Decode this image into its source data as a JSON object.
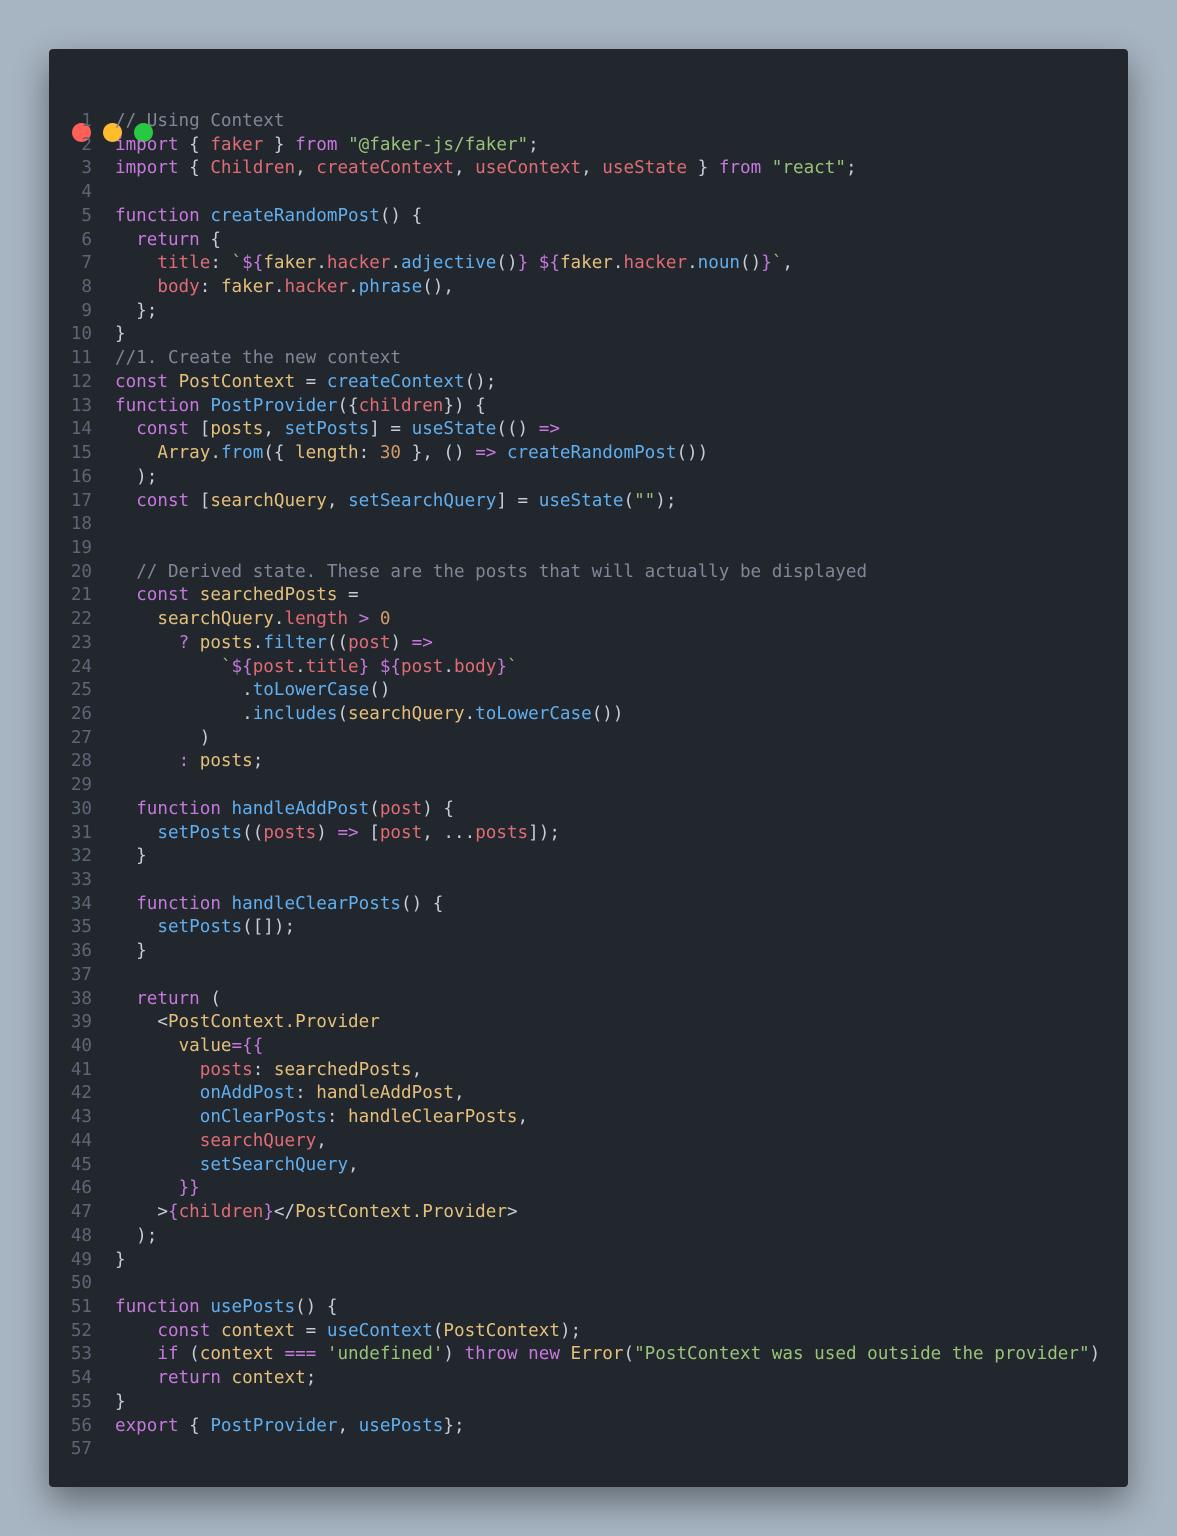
{
  "window": {
    "controls": [
      {
        "name": "close",
        "color": "#fe5f57"
      },
      {
        "name": "minimize",
        "color": "#febc2e"
      },
      {
        "name": "zoom",
        "color": "#28c840"
      }
    ]
  },
  "colors": {
    "background": "#a7b4c1",
    "editor": "#22272e",
    "keyword": "#c678dd",
    "function": "#61afef",
    "string": "#98c379",
    "variable": "#e06c75",
    "class": "#e5c07b",
    "comment": "#7f8896",
    "number": "#d19a66"
  },
  "code_lines": [
    [
      [
        "cm",
        "// Using Context"
      ]
    ],
    [
      [
        "kw",
        "import"
      ],
      [
        "p",
        " { "
      ],
      [
        "var",
        "faker"
      ],
      [
        "p",
        " } "
      ],
      [
        "kw",
        "from"
      ],
      [
        "p",
        " "
      ],
      [
        "str",
        "\"@faker-js/faker\""
      ],
      [
        "p",
        ";"
      ]
    ],
    [
      [
        "kw",
        "import"
      ],
      [
        "p",
        " { "
      ],
      [
        "var",
        "Children"
      ],
      [
        "p",
        ", "
      ],
      [
        "var",
        "createContext"
      ],
      [
        "p",
        ", "
      ],
      [
        "var",
        "useContext"
      ],
      [
        "p",
        ", "
      ],
      [
        "var",
        "useState"
      ],
      [
        "p",
        " } "
      ],
      [
        "kw",
        "from"
      ],
      [
        "p",
        " "
      ],
      [
        "str",
        "\"react\""
      ],
      [
        "p",
        ";"
      ]
    ],
    [],
    [
      [
        "kw",
        "function"
      ],
      [
        "p",
        " "
      ],
      [
        "fn",
        "createRandomPost"
      ],
      [
        "p",
        "() {"
      ]
    ],
    [
      [
        "p",
        "  "
      ],
      [
        "kw",
        "return"
      ],
      [
        "p",
        " {"
      ]
    ],
    [
      [
        "p",
        "    "
      ],
      [
        "var",
        "title"
      ],
      [
        "p",
        ": "
      ],
      [
        "str",
        "`"
      ],
      [
        "kw",
        "${"
      ],
      [
        "cls",
        "faker"
      ],
      [
        "p",
        "."
      ],
      [
        "var",
        "hacker"
      ],
      [
        "p",
        "."
      ],
      [
        "fn",
        "adjective"
      ],
      [
        "p",
        "()"
      ],
      [
        "kw",
        "}"
      ],
      [
        "str",
        " "
      ],
      [
        "kw",
        "${"
      ],
      [
        "cls",
        "faker"
      ],
      [
        "p",
        "."
      ],
      [
        "var",
        "hacker"
      ],
      [
        "p",
        "."
      ],
      [
        "fn",
        "noun"
      ],
      [
        "p",
        "()"
      ],
      [
        "kw",
        "}"
      ],
      [
        "str",
        "`"
      ],
      [
        "p",
        ","
      ]
    ],
    [
      [
        "p",
        "    "
      ],
      [
        "var",
        "body"
      ],
      [
        "p",
        ": "
      ],
      [
        "cls",
        "faker"
      ],
      [
        "p",
        "."
      ],
      [
        "var",
        "hacker"
      ],
      [
        "p",
        "."
      ],
      [
        "fn",
        "phrase"
      ],
      [
        "p",
        "(),"
      ]
    ],
    [
      [
        "p",
        "  };"
      ]
    ],
    [
      [
        "p",
        "}"
      ]
    ],
    [
      [
        "cm",
        "//1. Create the new context"
      ]
    ],
    [
      [
        "kw",
        "const"
      ],
      [
        "p",
        " "
      ],
      [
        "cls",
        "PostContext"
      ],
      [
        "p",
        " = "
      ],
      [
        "fn",
        "createContext"
      ],
      [
        "p",
        "();"
      ]
    ],
    [
      [
        "kw",
        "function"
      ],
      [
        "p",
        " "
      ],
      [
        "fn",
        "PostProvider"
      ],
      [
        "p",
        "({"
      ],
      [
        "var",
        "children"
      ],
      [
        "p",
        "}) {"
      ]
    ],
    [
      [
        "p",
        "  "
      ],
      [
        "kw",
        "const"
      ],
      [
        "p",
        " ["
      ],
      [
        "cls",
        "posts"
      ],
      [
        "p",
        ", "
      ],
      [
        "fn",
        "setPosts"
      ],
      [
        "p",
        "] = "
      ],
      [
        "fn",
        "useState"
      ],
      [
        "p",
        "(() "
      ],
      [
        "kw",
        "=>"
      ]
    ],
    [
      [
        "p",
        "    "
      ],
      [
        "cls",
        "Array"
      ],
      [
        "p",
        "."
      ],
      [
        "fn",
        "from"
      ],
      [
        "p",
        "({ "
      ],
      [
        "cls",
        "length"
      ],
      [
        "p",
        ": "
      ],
      [
        "num",
        "30"
      ],
      [
        "p",
        " }, () "
      ],
      [
        "kw",
        "=>"
      ],
      [
        "p",
        " "
      ],
      [
        "fn",
        "createRandomPost"
      ],
      [
        "p",
        "())"
      ]
    ],
    [
      [
        "p",
        "  );"
      ]
    ],
    [
      [
        "p",
        "  "
      ],
      [
        "kw",
        "const"
      ],
      [
        "p",
        " ["
      ],
      [
        "cls",
        "searchQuery"
      ],
      [
        "p",
        ", "
      ],
      [
        "fn",
        "setSearchQuery"
      ],
      [
        "p",
        "] = "
      ],
      [
        "fn",
        "useState"
      ],
      [
        "p",
        "("
      ],
      [
        "str",
        "\"\""
      ],
      [
        "p",
        ");"
      ]
    ],
    [],
    [],
    [
      [
        "p",
        "  "
      ],
      [
        "cm",
        "// Derived state. These are the posts that will actually be displayed"
      ]
    ],
    [
      [
        "p",
        "  "
      ],
      [
        "kw",
        "const"
      ],
      [
        "p",
        " "
      ],
      [
        "cls",
        "searchedPosts"
      ],
      [
        "p",
        " ="
      ]
    ],
    [
      [
        "p",
        "    "
      ],
      [
        "cls",
        "searchQuery"
      ],
      [
        "p",
        "."
      ],
      [
        "var",
        "length"
      ],
      [
        "p",
        " "
      ],
      [
        "kw",
        ">"
      ],
      [
        "p",
        " "
      ],
      [
        "num",
        "0"
      ]
    ],
    [
      [
        "p",
        "      "
      ],
      [
        "kw",
        "?"
      ],
      [
        "p",
        " "
      ],
      [
        "cls",
        "posts"
      ],
      [
        "p",
        "."
      ],
      [
        "fn",
        "filter"
      ],
      [
        "p",
        "(("
      ],
      [
        "var",
        "post"
      ],
      [
        "p",
        ") "
      ],
      [
        "kw",
        "=>"
      ]
    ],
    [
      [
        "p",
        "          "
      ],
      [
        "str",
        "`"
      ],
      [
        "kw",
        "${"
      ],
      [
        "var",
        "post"
      ],
      [
        "p",
        "."
      ],
      [
        "var",
        "title"
      ],
      [
        "kw",
        "}"
      ],
      [
        "str",
        " "
      ],
      [
        "kw",
        "${"
      ],
      [
        "var",
        "post"
      ],
      [
        "p",
        "."
      ],
      [
        "var",
        "body"
      ],
      [
        "kw",
        "}"
      ],
      [
        "str",
        "`"
      ]
    ],
    [
      [
        "p",
        "            ."
      ],
      [
        "fn",
        "toLowerCase"
      ],
      [
        "p",
        "()"
      ]
    ],
    [
      [
        "p",
        "            ."
      ],
      [
        "fn",
        "includes"
      ],
      [
        "p",
        "("
      ],
      [
        "cls",
        "searchQuery"
      ],
      [
        "p",
        "."
      ],
      [
        "fn",
        "toLowerCase"
      ],
      [
        "p",
        "())"
      ]
    ],
    [
      [
        "p",
        "        )"
      ]
    ],
    [
      [
        "p",
        "      "
      ],
      [
        "kw",
        ":"
      ],
      [
        "p",
        " "
      ],
      [
        "cls",
        "posts"
      ],
      [
        "p",
        ";"
      ]
    ],
    [],
    [
      [
        "p",
        "  "
      ],
      [
        "kw",
        "function"
      ],
      [
        "p",
        " "
      ],
      [
        "fn",
        "handleAddPost"
      ],
      [
        "p",
        "("
      ],
      [
        "var",
        "post"
      ],
      [
        "p",
        ") {"
      ]
    ],
    [
      [
        "p",
        "    "
      ],
      [
        "fn",
        "setPosts"
      ],
      [
        "p",
        "(("
      ],
      [
        "var",
        "posts"
      ],
      [
        "p",
        ") "
      ],
      [
        "kw",
        "=>"
      ],
      [
        "p",
        " ["
      ],
      [
        "var",
        "post"
      ],
      [
        "p",
        ", ..."
      ],
      [
        "var",
        "posts"
      ],
      [
        "p",
        "]);"
      ]
    ],
    [
      [
        "p",
        "  }"
      ]
    ],
    [],
    [
      [
        "p",
        "  "
      ],
      [
        "kw",
        "function"
      ],
      [
        "p",
        " "
      ],
      [
        "fn",
        "handleClearPosts"
      ],
      [
        "p",
        "() {"
      ]
    ],
    [
      [
        "p",
        "    "
      ],
      [
        "fn",
        "setPosts"
      ],
      [
        "p",
        "([]);"
      ]
    ],
    [
      [
        "p",
        "  }"
      ]
    ],
    [],
    [
      [
        "p",
        "  "
      ],
      [
        "kw",
        "return"
      ],
      [
        "p",
        " ("
      ]
    ],
    [
      [
        "p",
        "    <"
      ],
      [
        "cls",
        "PostContext.Provider"
      ]
    ],
    [
      [
        "p",
        "      "
      ],
      [
        "cls",
        "value"
      ],
      [
        "kw",
        "={{"
      ]
    ],
    [
      [
        "p",
        "        "
      ],
      [
        "var",
        "posts"
      ],
      [
        "p",
        ": "
      ],
      [
        "cls",
        "searchedPosts"
      ],
      [
        "p",
        ","
      ]
    ],
    [
      [
        "p",
        "        "
      ],
      [
        "fn",
        "onAddPost"
      ],
      [
        "p",
        ": "
      ],
      [
        "cls",
        "handleAddPost"
      ],
      [
        "p",
        ","
      ]
    ],
    [
      [
        "p",
        "        "
      ],
      [
        "fn",
        "onClearPosts"
      ],
      [
        "p",
        ": "
      ],
      [
        "cls",
        "handleClearPosts"
      ],
      [
        "p",
        ","
      ]
    ],
    [
      [
        "p",
        "        "
      ],
      [
        "var",
        "searchQuery"
      ],
      [
        "p",
        ","
      ]
    ],
    [
      [
        "p",
        "        "
      ],
      [
        "fn",
        "setSearchQuery"
      ],
      [
        "p",
        ","
      ]
    ],
    [
      [
        "p",
        "      "
      ],
      [
        "kw",
        "}}"
      ]
    ],
    [
      [
        "p",
        "    >"
      ],
      [
        "kw",
        "{"
      ],
      [
        "var",
        "children"
      ],
      [
        "kw",
        "}"
      ],
      [
        "p",
        "</"
      ],
      [
        "cls",
        "PostContext.Provider"
      ],
      [
        "p",
        ">"
      ]
    ],
    [
      [
        "p",
        "  );"
      ]
    ],
    [
      [
        "p",
        "}"
      ]
    ],
    [],
    [
      [
        "kw",
        "function"
      ],
      [
        "p",
        " "
      ],
      [
        "fn",
        "usePosts"
      ],
      [
        "p",
        "() {"
      ]
    ],
    [
      [
        "p",
        "    "
      ],
      [
        "kw",
        "const"
      ],
      [
        "p",
        " "
      ],
      [
        "cls",
        "context"
      ],
      [
        "p",
        " = "
      ],
      [
        "fn",
        "useContext"
      ],
      [
        "p",
        "("
      ],
      [
        "cls",
        "PostContext"
      ],
      [
        "p",
        ");"
      ]
    ],
    [
      [
        "p",
        "    "
      ],
      [
        "kw",
        "if"
      ],
      [
        "p",
        " ("
      ],
      [
        "cls",
        "context"
      ],
      [
        "p",
        " "
      ],
      [
        "kw",
        "==="
      ],
      [
        "p",
        " "
      ],
      [
        "str",
        "'undefined'"
      ],
      [
        "p",
        ") "
      ],
      [
        "kw",
        "throw"
      ],
      [
        "p",
        " "
      ],
      [
        "kw",
        "new"
      ],
      [
        "p",
        " "
      ],
      [
        "cls",
        "Error"
      ],
      [
        "p",
        "("
      ],
      [
        "str",
        "\"PostContext was used outside the provider\""
      ],
      [
        "p",
        ")"
      ]
    ],
    [
      [
        "p",
        "    "
      ],
      [
        "kw",
        "return"
      ],
      [
        "p",
        " "
      ],
      [
        "cls",
        "context"
      ],
      [
        "p",
        ";"
      ]
    ],
    [
      [
        "p",
        "}"
      ]
    ],
    [
      [
        "kw",
        "export"
      ],
      [
        "p",
        " { "
      ],
      [
        "fn",
        "PostProvider"
      ],
      [
        "p",
        ", "
      ],
      [
        "fn",
        "usePosts"
      ],
      [
        "p",
        "};"
      ]
    ],
    []
  ]
}
